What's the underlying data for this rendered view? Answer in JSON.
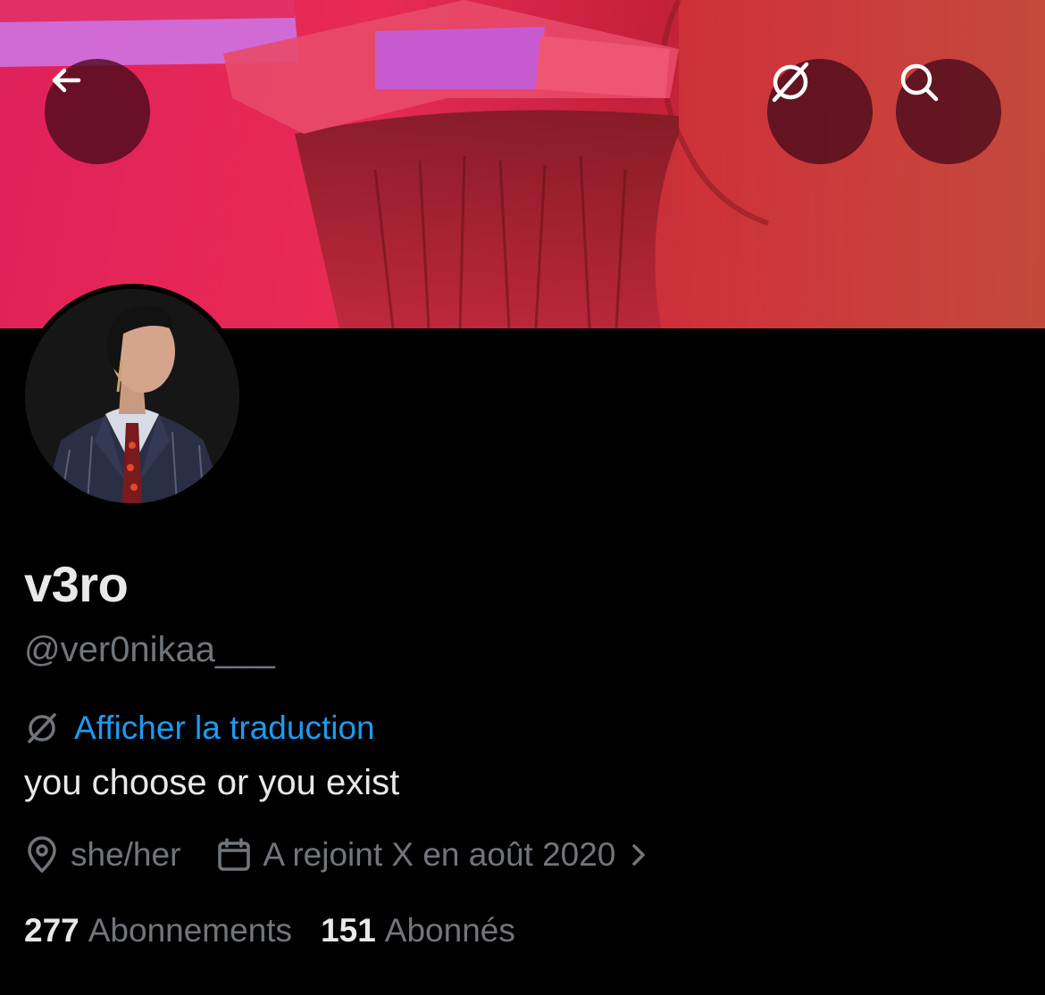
{
  "profile": {
    "display_name": "v3ro",
    "handle": "@ver0nikaa___",
    "translate_label": "Afficher la traduction",
    "bio": "you choose or you exist",
    "pronouns": "she/her",
    "joined": "A rejoint X en août 2020",
    "following_count": "277",
    "following_label": "Abonnements",
    "followers_count": "151",
    "followers_label": "Abonnés"
  },
  "icons": {
    "back": "arrow-left-icon",
    "translate": "translate-icon",
    "search": "search-icon",
    "location": "location-pin-icon",
    "calendar": "calendar-icon",
    "chevron": "chevron-right-icon"
  },
  "colors": {
    "background": "#000000",
    "text_primary": "#e7e9ea",
    "text_secondary": "#71767b",
    "link": "#1d9bf0"
  }
}
